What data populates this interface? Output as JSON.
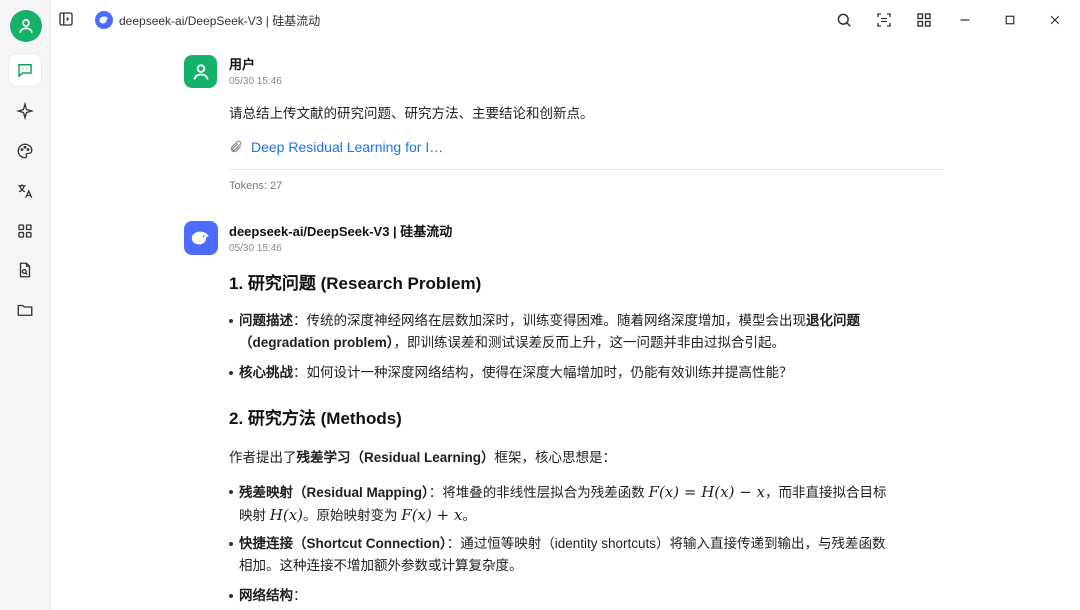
{
  "window": {
    "tab_title": "deepseek-ai/DeepSeek-V3 | 硅基流动"
  },
  "sidebar": {
    "items": [
      {
        "name": "chat",
        "icon": "chat-icon",
        "active": true
      },
      {
        "name": "agents",
        "icon": "sparkle-icon"
      },
      {
        "name": "paint",
        "icon": "palette-icon"
      },
      {
        "name": "translate",
        "icon": "translate-icon"
      },
      {
        "name": "apps",
        "icon": "apps-grid-icon"
      },
      {
        "name": "files",
        "icon": "file-search-icon"
      },
      {
        "name": "folder",
        "icon": "folder-icon"
      }
    ]
  },
  "user_message": {
    "name": "用户",
    "time": "05/30 15:46",
    "text": "请总结上传文献的研究问题、研究方法、主要结论和创新点。",
    "attachment": "Deep Residual Learning for I…",
    "tokens": "Tokens: 27"
  },
  "model_message": {
    "name": "deepseek-ai/DeepSeek-V3 | 硅基流动",
    "time": "05/30 15:46",
    "section1_title": "1. 研究问题 (Research Problem)",
    "b1_label": "问题描述",
    "b1_text_a": "：传统的深度神经网络在层数加深时，训练变得困难。随着网络深度增加，模型会出现",
    "b1_bold": "退化问题",
    "b1_text_b": "（degradation problem）",
    "b1_text_c": "，即训练误差和测试误差反而上升，这一问题并非由过拟合引起。",
    "b2_label": "核心挑战",
    "b2_text": "：如何设计一种深度网络结构，使得在深度大幅增加时，仍能有效训练并提高性能？",
    "section2_title": "2. 研究方法 (Methods)",
    "p_intro_a": "作者提出了",
    "p_intro_bold": "残差学习（Residual Learning）",
    "p_intro_b": "框架，核心思想是：",
    "m1_label": "残差映射（Residual Mapping）",
    "m1_text_a": "：将堆叠的非线性层拟合为残差函数",
    "m1_math_a": "F(x) = H(x) − x",
    "m1_text_b": "，而非直接拟合目标",
    "m1_text_c": "映射",
    "m1_math_b": "H(x)",
    "m1_text_d": "。原始映射变为",
    "m1_math_c": "F(x) + x",
    "m1_text_e": "。",
    "m2_label": "快捷连接（Shortcut Connection）",
    "m2_text_a": "：通过恒等映射（identity shortcuts）将输入直接传递到输出，与残差函数",
    "m2_text_b": "相加。这种连接不增加额外参数或计算复杂度。",
    "m3_label": "网络结构",
    "m3_text": "："
  }
}
